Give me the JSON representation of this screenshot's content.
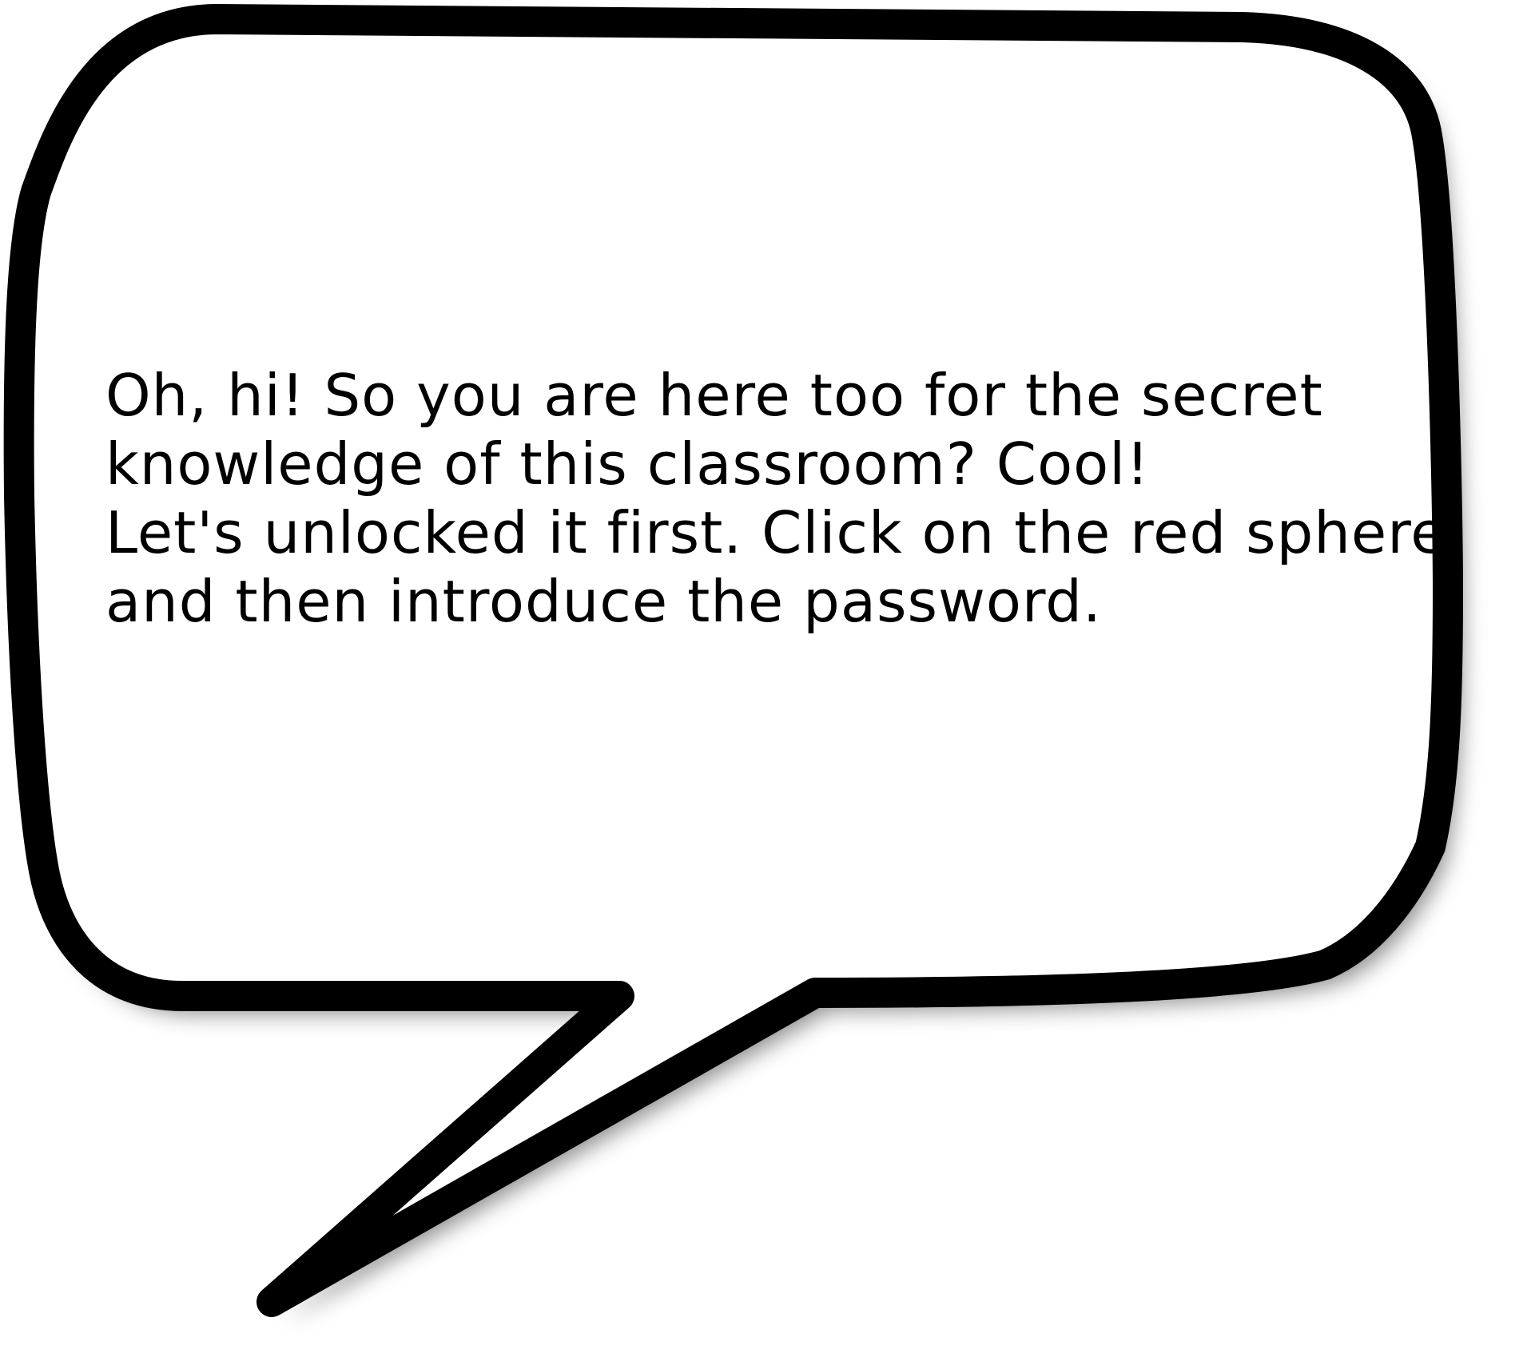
{
  "speech_bubble": {
    "lines": [
      "Oh, hi! So you are here too for the secret",
      "knowledge of this classroom? Cool!",
      "Let's unlocked it first. Click on the red sphere",
      "and then introduce the password."
    ]
  },
  "colors": {
    "background": "#ffffff",
    "bubble_fill": "#ffffff",
    "bubble_outline": "#000000",
    "shadow": "#000000",
    "text": "#000000"
  }
}
